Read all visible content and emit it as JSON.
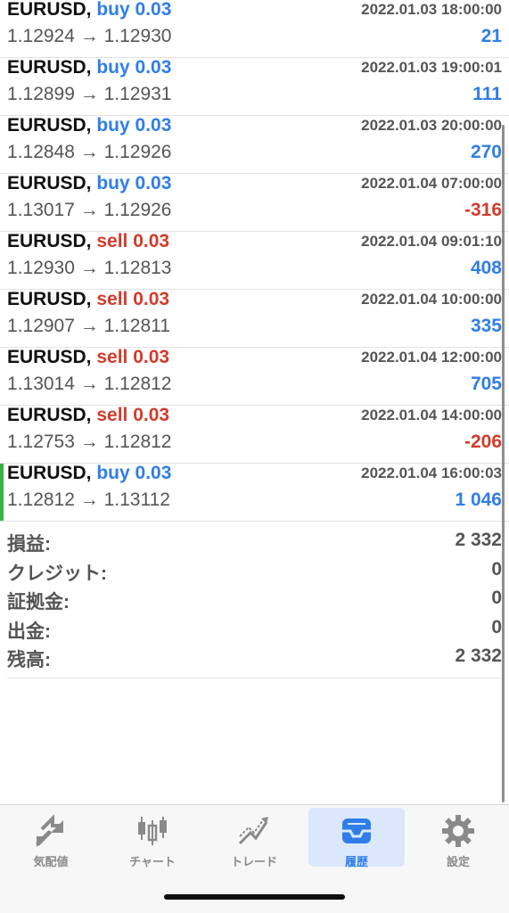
{
  "trades": [
    {
      "symbol": "EURUSD,",
      "dir": "buy 0.03",
      "time": "2022.01.03 18:00:00",
      "prices": "1.12924 → 1.12930",
      "profit": "21",
      "profit_sign": "pos",
      "active": false
    },
    {
      "symbol": "EURUSD,",
      "dir": "buy 0.03",
      "time": "2022.01.03 19:00:01",
      "prices": "1.12899 → 1.12931",
      "profit": "111",
      "profit_sign": "pos",
      "active": false
    },
    {
      "symbol": "EURUSD,",
      "dir": "buy 0.03",
      "time": "2022.01.03 20:00:00",
      "prices": "1.12848 → 1.12926",
      "profit": "270",
      "profit_sign": "pos",
      "active": false
    },
    {
      "symbol": "EURUSD,",
      "dir": "buy 0.03",
      "time": "2022.01.04 07:00:00",
      "prices": "1.13017 → 1.12926",
      "profit": "-316",
      "profit_sign": "neg",
      "active": false
    },
    {
      "symbol": "EURUSD,",
      "dir": "sell 0.03",
      "time": "2022.01.04 09:01:10",
      "prices": "1.12930 → 1.12813",
      "profit": "408",
      "profit_sign": "pos",
      "active": false
    },
    {
      "symbol": "EURUSD,",
      "dir": "sell 0.03",
      "time": "2022.01.04 10:00:00",
      "prices": "1.12907 → 1.12811",
      "profit": "335",
      "profit_sign": "pos",
      "active": false
    },
    {
      "symbol": "EURUSD,",
      "dir": "sell 0.03",
      "time": "2022.01.04 12:00:00",
      "prices": "1.13014 → 1.12812",
      "profit": "705",
      "profit_sign": "pos",
      "active": false
    },
    {
      "symbol": "EURUSD,",
      "dir": "sell 0.03",
      "time": "2022.01.04 14:00:00",
      "prices": "1.12753 → 1.12812",
      "profit": "-206",
      "profit_sign": "neg",
      "active": false
    },
    {
      "symbol": "EURUSD,",
      "dir": "buy 0.03",
      "time": "2022.01.04 16:00:03",
      "prices": "1.12812 → 1.13112",
      "profit": "1 046",
      "profit_sign": "pos",
      "active": true
    }
  ],
  "summary": [
    {
      "label": "損益:",
      "value": "2 332"
    },
    {
      "label": "クレジット:",
      "value": "0"
    },
    {
      "label": "証拠金:",
      "value": "0"
    },
    {
      "label": "出金:",
      "value": "0"
    },
    {
      "label": "残高:",
      "value": "2 332"
    }
  ],
  "tabs": [
    {
      "name": "quotes",
      "label": "気配値",
      "icon": "quotes-arrows-icon",
      "selected": false
    },
    {
      "name": "chart",
      "label": "チャート",
      "icon": "candlestick-chart-icon",
      "selected": false
    },
    {
      "name": "trade",
      "label": "トレード",
      "icon": "trade-trend-icon",
      "selected": false
    },
    {
      "name": "history",
      "label": "履歴",
      "icon": "inbox-tray-icon",
      "selected": true
    },
    {
      "name": "settings",
      "label": "設定",
      "icon": "gear-icon",
      "selected": false
    }
  ],
  "colors": {
    "buy": "#2f7ee8",
    "sell": "#d23b2b",
    "active_marker": "#3cb043",
    "tab_selected_bg": "#dbe8fb"
  }
}
